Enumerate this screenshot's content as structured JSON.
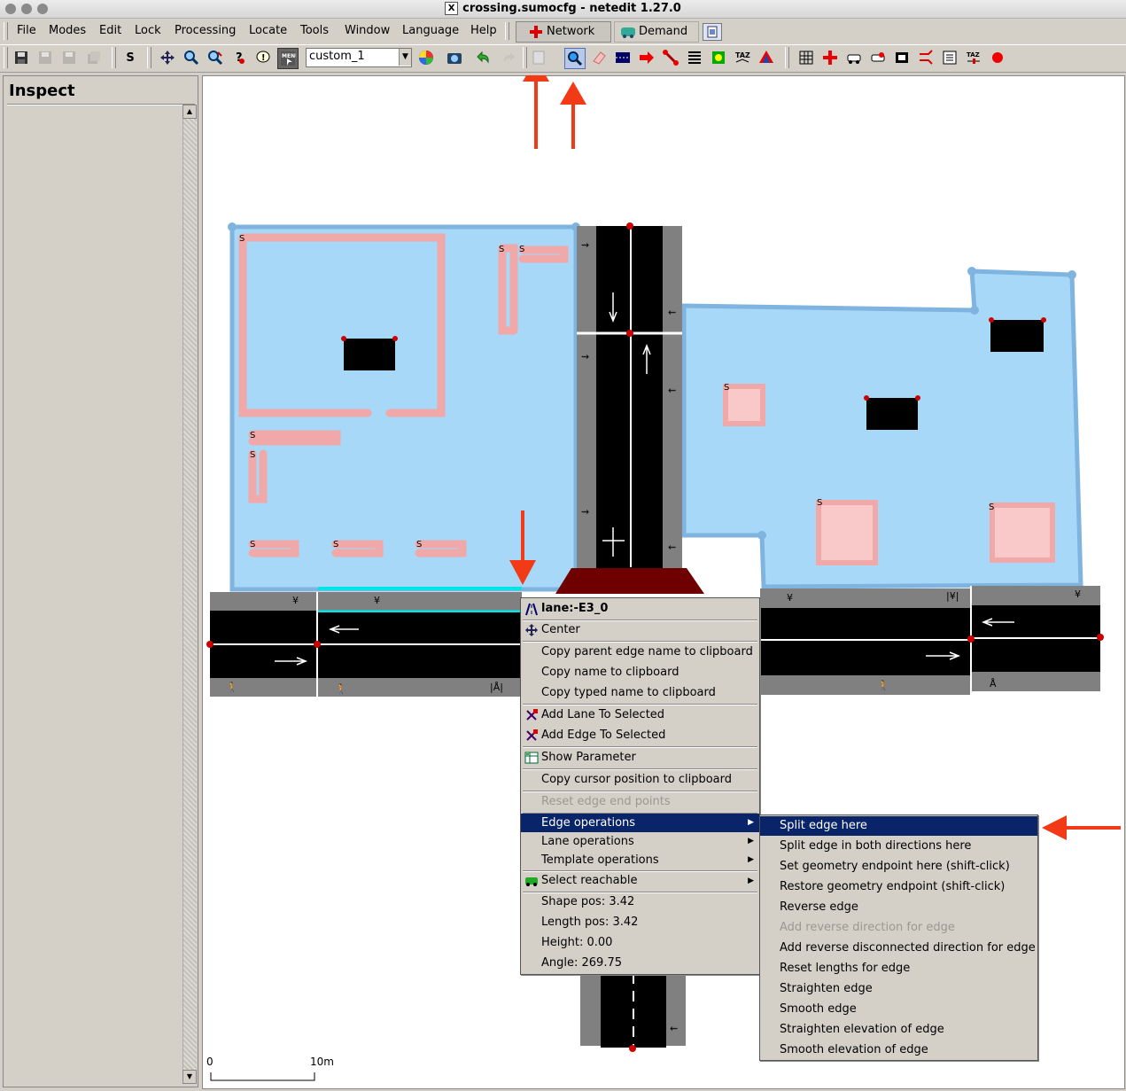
{
  "window": {
    "title": "crossing.sumocfg - netedit 1.27.0",
    "title_logo": "X"
  },
  "menubar": {
    "items": [
      "File",
      "Modes",
      "Edit",
      "Lock",
      "Processing",
      "Locate",
      "Tools",
      "Window",
      "Language",
      "Help"
    ],
    "supermodes": {
      "network": "Network",
      "demand": "Demand"
    }
  },
  "toolbar": {
    "save_label": "S",
    "viewport_combo": "custom_1"
  },
  "left_panel": {
    "title": "Inspect"
  },
  "scale": {
    "start": "0",
    "end": "10m"
  },
  "context_menu": {
    "header": "lane:-E3_0",
    "items": {
      "center": "Center",
      "copy_parent": "Copy parent edge name to clipboard",
      "copy_name": "Copy name to clipboard",
      "copy_typed": "Copy typed name to clipboard",
      "add_lane": "Add Lane To Selected",
      "add_edge": "Add Edge To Selected",
      "show_param": "Show Parameter",
      "copy_cursor": "Copy cursor position to clipboard",
      "reset_endpoints": "Reset edge end points",
      "edge_ops": "Edge operations",
      "lane_ops": "Lane operations",
      "template_ops": "Template operations",
      "select_reachable": "Select reachable",
      "shape_pos": "Shape pos: 3.42",
      "length_pos": "Length pos: 3.42",
      "height": "Height: 0.00",
      "angle": "Angle: 269.75"
    }
  },
  "submenu": {
    "items": [
      "Split edge here",
      "Split edge in both directions here",
      "Set geometry endpoint here (shift-click)",
      "Restore geometry endpoint (shift-click)",
      "Reverse edge",
      "Add reverse direction for edge",
      "Add reverse disconnected direction for edge",
      "Reset lengths for edge",
      "Straighten edge",
      "Smooth edge",
      "Straighten elevation of edge",
      "Smooth elevation of edge"
    ],
    "selected_index": 0,
    "disabled_index": 5
  },
  "map_labels": {
    "parking_marker": "S"
  },
  "colors": {
    "annotation_red": "#f23a17",
    "selection_blue": "#0a246a",
    "polygon_fill": "#a8d8f8",
    "polygon_border": "#7fb4e0",
    "poi_pink": "#f0a8a8",
    "junction_red": "#cc0000",
    "crossing_dark_red": "#6e0000"
  }
}
